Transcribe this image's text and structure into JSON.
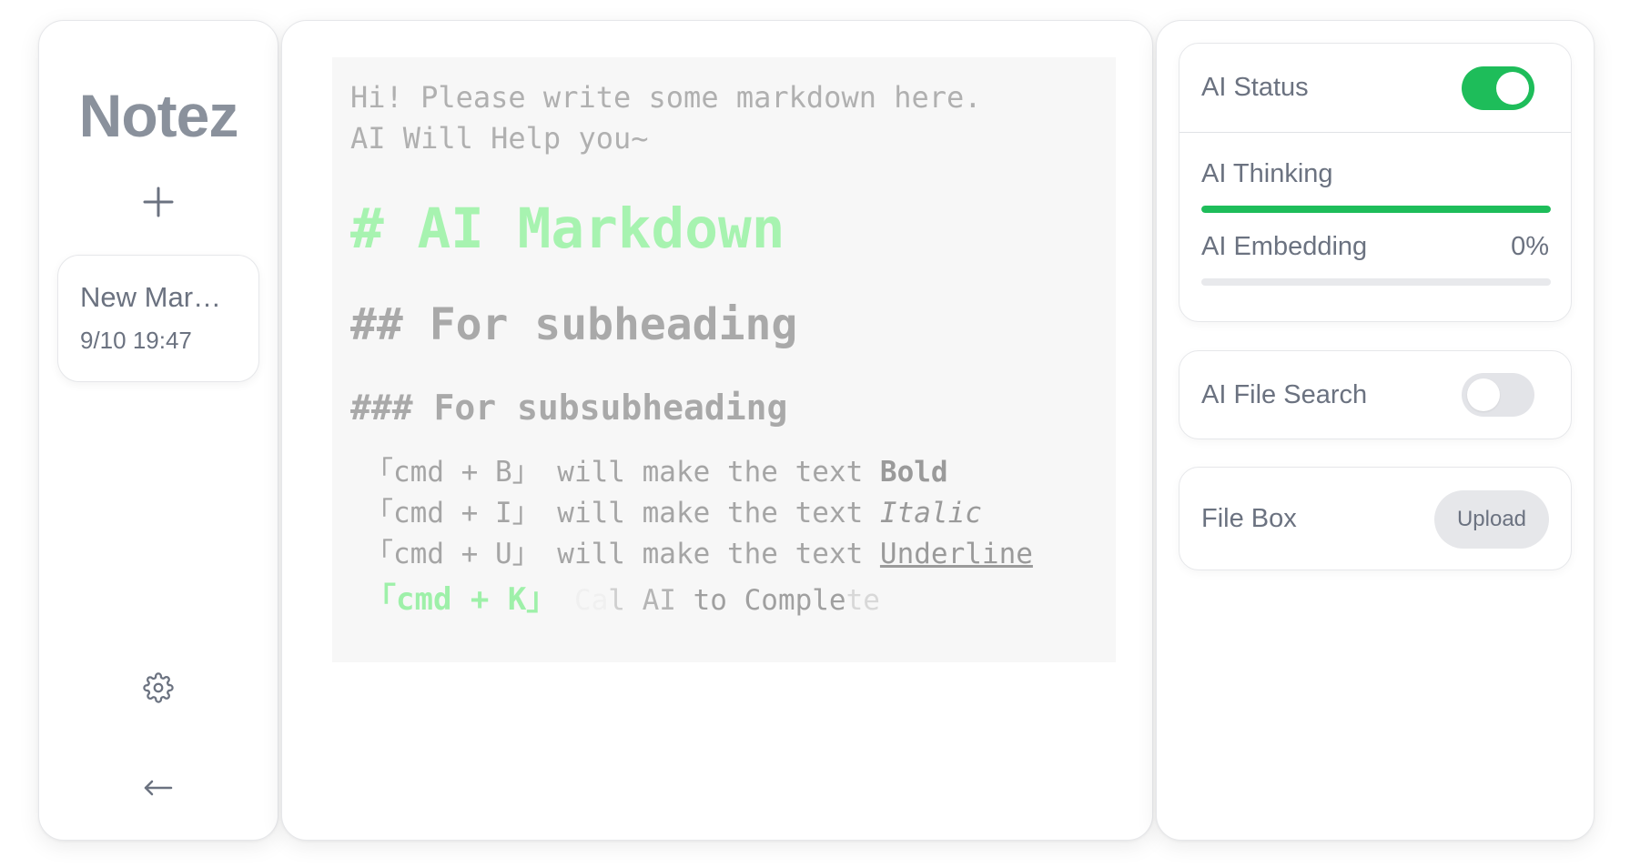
{
  "sidebar": {
    "logo": "Notez",
    "add_icon": "plus-icon",
    "notes": [
      {
        "title": "New Mar…",
        "date": "9/10 19:47"
      }
    ],
    "settings_icon": "gear-icon",
    "back_icon": "arrow-left-icon"
  },
  "editor": {
    "placeholder_line1": "Hi! Please write some markdown here.",
    "placeholder_line2": "AI Will Help you~",
    "h1": "# AI Markdown",
    "h2": "## For subheading",
    "h3": "### For subsubheading",
    "tips": [
      {
        "prefix": "「cmd + B」 will make the text ",
        "styled": "Bold"
      },
      {
        "prefix": "「cmd + I」 will make the text ",
        "styled": "Italic"
      },
      {
        "prefix": "「cmd + U」 will make the text ",
        "styled": "Underline"
      }
    ],
    "tip_k": {
      "key": "「cmd + K」",
      "seg1": " C",
      "seg2": "a",
      "seg3": "l",
      "seg4": " AI ",
      "seg5": "to Comple",
      "seg6": "te"
    }
  },
  "ai_panel": {
    "status_label": "AI Status",
    "status_on": true,
    "thinking_label": "AI Thinking",
    "thinking_progress": 1.0,
    "embedding_label": "AI Embedding",
    "embedding_percent": "0%",
    "embedding_progress": 0,
    "file_search_label": "AI File Search",
    "file_search_on": false,
    "file_box_label": "File Box",
    "upload_label": "Upload"
  },
  "colors": {
    "accent_green": "#1ebd5a",
    "heading_green": "#a7f3b0",
    "logo_gray": "#8a919c",
    "editor_bg": "#f7f7f7"
  }
}
